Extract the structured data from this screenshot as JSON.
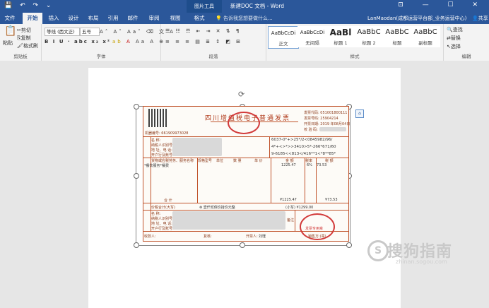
{
  "titlebar": {
    "context_tab": "图片工具",
    "doc_title": "新建DOC 文档 - Word",
    "quick_access": "💾 ↶ ↷ ⌄"
  },
  "tabs": [
    "文件",
    "开始",
    "插入",
    "设计",
    "布局",
    "引用",
    "邮件",
    "审阅",
    "视图",
    "格式"
  ],
  "tell_me": "告诉我您想要做什么...",
  "user": "LanMaodan(成都运营平台部_业务运营中心)",
  "share": "共享",
  "ribbon": {
    "clipboard": {
      "paste": "粘贴",
      "cut": "剪切",
      "copy": "复制",
      "format_painter": "格式刷",
      "label": "剪贴板"
    },
    "font": {
      "name": "等线 (西文正)",
      "size": "五号",
      "label": "字体",
      "btns": "B I U · abc x₂ x²"
    },
    "paragraph": {
      "label": "段落"
    },
    "styles": {
      "label": "样式",
      "items": [
        {
          "preview": "AaBbCcDi",
          "name": "正文"
        },
        {
          "preview": "AaBbCcDi",
          "name": "无间隔"
        },
        {
          "preview": "AaBl",
          "name": "标题 1"
        },
        {
          "preview": "AaBbC",
          "name": "标题 2"
        },
        {
          "preview": "AaBbC",
          "name": "标题"
        },
        {
          "preview": "AaBbC",
          "name": "副标题"
        }
      ]
    },
    "editing": {
      "find": "查找",
      "replace": "替换",
      "select": "选择",
      "label": "编辑"
    }
  },
  "invoice": {
    "title": "四川增值税电子普通发票",
    "code_label": "发票代码: 051001800111",
    "num_label": "发票号码: 25904214",
    "date_label": "开票日期: 2019 年08月04日",
    "check_label": "校 验 码:",
    "machine": "机器编号: 661909973028",
    "buyer_name": "名    称:",
    "buyer_id": "纳税人识别号:",
    "buyer_addr": "地 址、电 话:",
    "buyer_bank": "开户行及账号:",
    "cipher1": "6037-0*+>25*/2<0845982/96/",
    "cipher2": "4*+<>*>>3410>5*-266*671/60",
    "cipher3": "9-6185<<813</416**1<*8**85*",
    "item_header": "货物或应税劳务、服务名称",
    "spec": "规格型号",
    "unit": "单位",
    "qty": "数 量",
    "price": "单 价",
    "amount": "金 额",
    "rate": "税率",
    "tax": "税 额",
    "item1": "*餐饮服务*餐费",
    "amount1": "1225.47",
    "rate1": "6%",
    "tax1": "73.53",
    "subtotal": "合    计",
    "sub_amount": "¥1225.47",
    "sub_tax": "¥73.53",
    "total_label": "价税合计(大写)",
    "total_text": "⊗ 壹仟贰佰玖拾玖元整",
    "total_small": "(小写) ¥1299.00",
    "seller_name": "名    称:",
    "seller_id": "纳税人识别号:",
    "seller_addr": "地 址、电 话:",
    "seller_bank": "开户行及账号:",
    "remark": "备注",
    "payee": "收款人:",
    "reviewer": "复核:",
    "drawer": "开票人:",
    "drawer_name": "刘瑾",
    "seller_seal": "销售方:(章)",
    "seal_text": "发票专用章"
  },
  "watermark": {
    "brand": "搜狗指南",
    "url": "zhinan.sogou.com",
    "icon": "S"
  }
}
